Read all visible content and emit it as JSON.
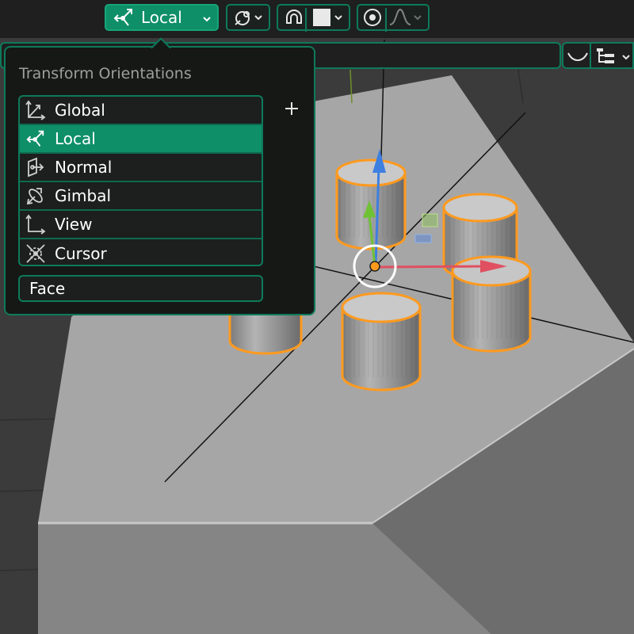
{
  "header": {
    "orientation_label": "Local"
  },
  "popup": {
    "title": "Transform Orientations",
    "items": [
      {
        "label": "Global",
        "icon": "global-axes-icon",
        "selected": false
      },
      {
        "label": "Local",
        "icon": "local-axes-icon",
        "selected": true
      },
      {
        "label": "Normal",
        "icon": "normal-icon",
        "selected": false
      },
      {
        "label": "Gimbal",
        "icon": "gimbal-icon",
        "selected": false
      },
      {
        "label": "View",
        "icon": "view-axes-icon",
        "selected": false
      },
      {
        "label": "Cursor",
        "icon": "cursor-icon",
        "selected": false
      }
    ],
    "add_icon": "plus-icon",
    "name_field_value": "Face"
  },
  "colors": {
    "accent": "#0e8f67",
    "border": "#0e7a5b",
    "selection_outline": "#ff9a1f",
    "axis_x": "#e05060",
    "axis_y": "#6fc234",
    "axis_z": "#3e7fe0"
  }
}
